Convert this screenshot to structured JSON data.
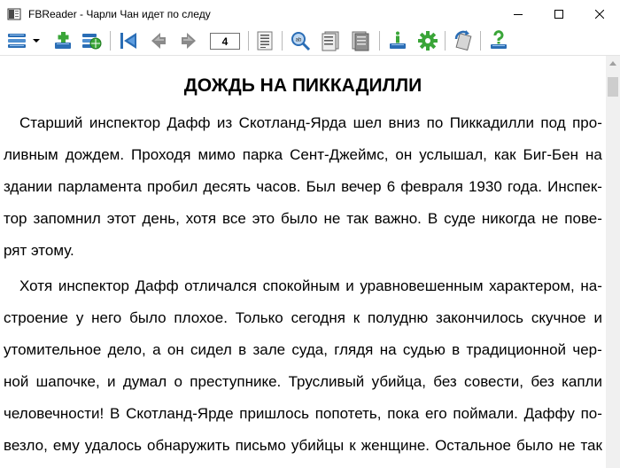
{
  "window": {
    "title": "FBReader - Чарли Чан идет по следу"
  },
  "toolbar": {
    "page_number": "4",
    "icons": [
      "library-icon",
      "dropdown-arrow-icon",
      "add-book-icon",
      "network-library-icon",
      "go-to-start-icon",
      "back-icon",
      "forward-icon",
      "table-of-contents-icon",
      "search-icon",
      "previous-page-icon",
      "next-page-icon",
      "book-info-icon",
      "settings-icon",
      "rotate-icon",
      "help-icon"
    ]
  },
  "book": {
    "chapter_title": "ДОЖДЬ НА ПИККАДИЛЛИ",
    "lines": [
      "Старший инспектор Дафф из Скотланд-Ярда шел вниз по Пиккадилли под про-",
      "ливным дождем. Проходя мимо парка Сент-Джеймс, он услышал, как Биг-Бен на",
      "здании парламента пробил десять часов. Был вечер 6 февраля 1930 года. Инспек-",
      "тор запомнил этот день, хотя все это было не так важно. В суде никогда не пове-",
      "рят этому.",
      "Хотя инспектор Дафф отличался спокойным и уравновешенным характером, на-",
      "строение у него было плохое. Только сегодня к полудню закончилось скучное и",
      "утомительное дело, а он сидел в зале суда, глядя на судью в традиционной чер-",
      "ной шапочке, и думал о преступнике. Трусливый убийца, без совести, без капли",
      "человечности! В Скотланд-Ярде пришлось попотеть, пока его поймали. Даффу по-",
      "везло, ему удалось обнаружить письмо убийцы к женщине. Остальное было не так"
    ]
  },
  "colors": {
    "toolbar_blue": "#1f6fb8",
    "toolbar_green": "#3aa538",
    "toolbar_gray": "#8a8a8a"
  }
}
